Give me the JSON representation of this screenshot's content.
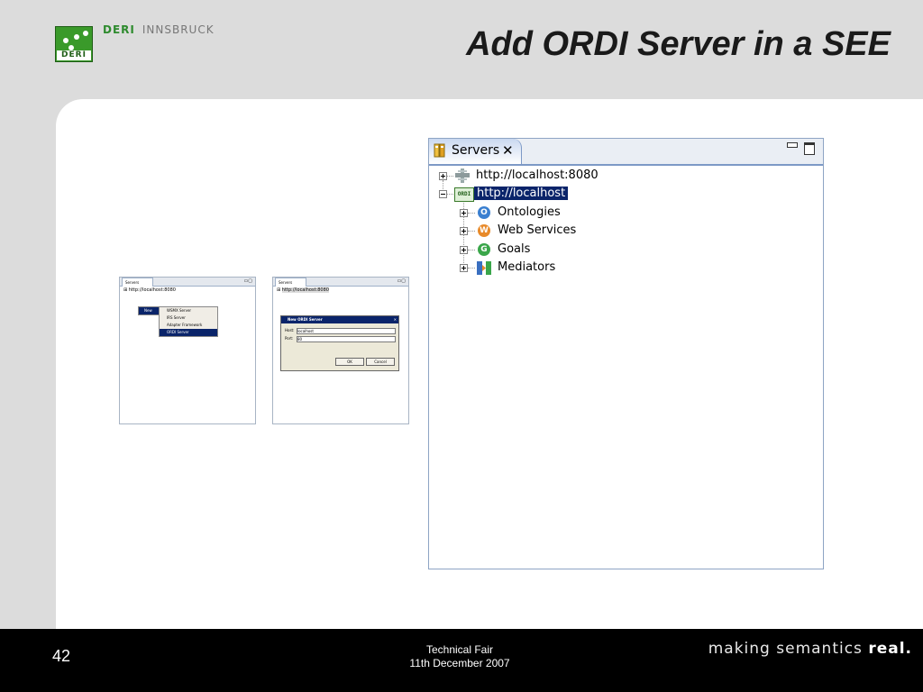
{
  "header": {
    "org_primary": "DERI",
    "org_secondary": "INNSBRUCK",
    "logo_text": "DERI",
    "title": "Add ORDI Server in a SEE"
  },
  "thumb_left": {
    "tab": "Servers",
    "server": "http://localhost:8080",
    "new_button": "New",
    "menu": [
      "WSMX Server",
      "IRS Server",
      "Adapter Framework",
      "ORDI Server"
    ]
  },
  "thumb_right": {
    "tab": "Servers",
    "server": "http://localhost:8080",
    "dialog": {
      "title": "New ORDI Server",
      "host_label": "Host:",
      "host_value": "localhost",
      "port_label": "Port:",
      "port_value": "80",
      "ok": "OK",
      "cancel": "Cancel"
    }
  },
  "servers_view": {
    "tab_label": "Servers",
    "nodes": [
      {
        "label": "http://localhost:8080",
        "expanded": false
      },
      {
        "label": "http://localhost",
        "expanded": true,
        "selected": true,
        "icon_text": "ORDI"
      }
    ],
    "children": [
      {
        "label": "Ontologies",
        "icon": "ontology-icon",
        "color": "#3a7fd0",
        "glyph": "O"
      },
      {
        "label": "Web Services",
        "icon": "web-service-icon",
        "color": "#e88a2a",
        "glyph": "W"
      },
      {
        "label": "Goals",
        "icon": "goal-icon",
        "color": "#3aa64a",
        "glyph": "G"
      },
      {
        "label": "Mediators",
        "icon": "mediator-icon",
        "color": "#3a6fc0",
        "glyph": ""
      }
    ]
  },
  "footer": {
    "page_number": "42",
    "event": "Technical Fair",
    "date": "11th December 2007",
    "tagline_prefix": "making semantics ",
    "tagline_emph": "real."
  }
}
